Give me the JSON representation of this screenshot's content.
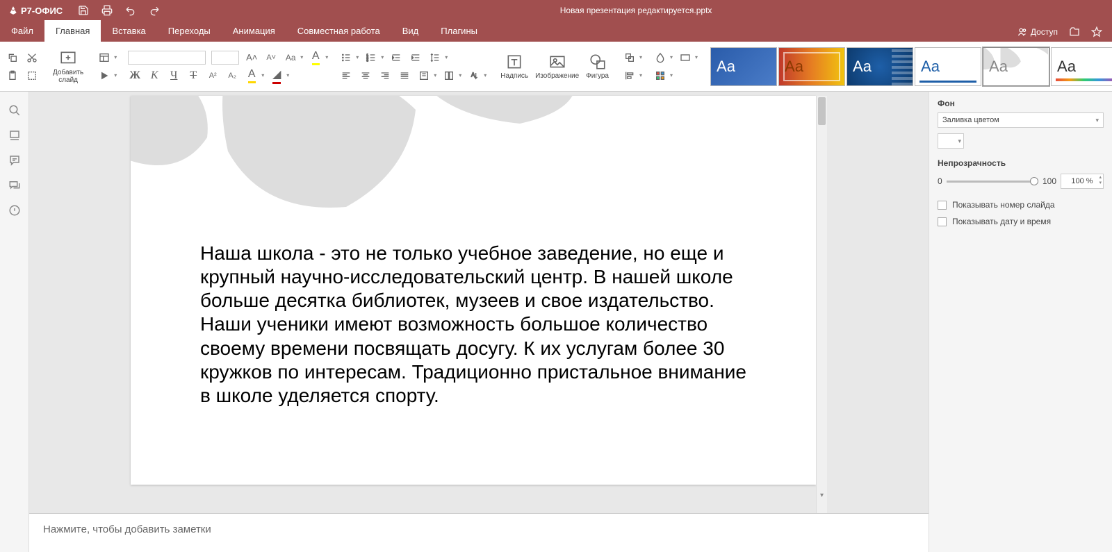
{
  "app": {
    "name": "Р7-ОФИС",
    "title": "Новая презентация редактируется.pptx"
  },
  "menus": {
    "file": "Файл",
    "home": "Главная",
    "insert": "Вставка",
    "transitions": "Переходы",
    "animation": "Анимация",
    "collab": "Совместная работа",
    "view": "Вид",
    "plugins": "Плагины",
    "access": "Доступ"
  },
  "ribbon": {
    "addSlide": "Добавить\nслайд",
    "textbox": "Надпись",
    "image": "Изображение",
    "shape": "Фигура"
  },
  "slide": {
    "body": "Наша школа - это не только учебное заведение, но еще и крупный научно-исследовательский центр. В нашей школе больше десятка библиотек, музеев и свое издательство. Наши ученики имеют возможность большое количество своему времени посвящать досугу. К их услугам более 30 кружков по интересам. Традиционно пристальное внимание в школе уделяется спорту."
  },
  "notes": {
    "placeholder": "Нажмите, чтобы добавить заметки"
  },
  "panel": {
    "bg": "Фон",
    "fillType": "Заливка цветом",
    "opacity": "Непрозрачность",
    "min": "0",
    "max": "100",
    "val": "100 %",
    "showNum": "Показывать номер слайда",
    "showDate": "Показывать дату и время"
  }
}
